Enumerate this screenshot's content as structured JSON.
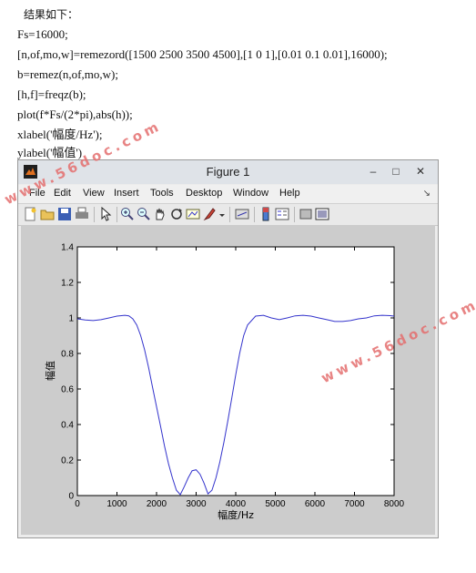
{
  "document": {
    "heading": "结果如下：",
    "code_lines": [
      "Fs=16000;",
      "[n,of,mo,w]=remezord([1500 2500 3500 4500],[1 0 1],[0.01 0.1 0.01],16000);",
      "b=remez(n,of,mo,w);",
      "[h,f]=freqz(b);",
      "plot(f*Fs/(2*pi),abs(h));",
      "xlabel('幅度/Hz');",
      "ylabel('幅值')"
    ]
  },
  "window": {
    "title": "Figure 1",
    "controls": {
      "minimize": "–",
      "maximize": "□",
      "close": "✕"
    },
    "menu": [
      "File",
      "Edit",
      "View",
      "Insert",
      "Tools",
      "Desktop",
      "Window",
      "Help"
    ],
    "menu_overflow": "↘",
    "toolbar_icons": [
      "new-figure-icon",
      "open-file-icon",
      "save-icon",
      "print-icon",
      "pointer-icon",
      "zoom-in-icon",
      "zoom-out-icon",
      "pan-icon",
      "rotate-icon",
      "data-cursor-icon",
      "brush-icon",
      "link-plot-icon",
      "colorbar-icon",
      "legend-icon",
      "hide-plot-tools-icon",
      "show-plot-tools-icon"
    ]
  },
  "watermarks": [
    "www.56doc.com",
    "www.56doc.com"
  ],
  "colors": {
    "line": "#3333cc",
    "plot_bg": "#ffffff",
    "figure_bg": "#cccccc",
    "watermark": "#e46f6f"
  },
  "chart_data": {
    "type": "line",
    "xlabel": "幅度/Hz",
    "ylabel": "幅值",
    "xlim": [
      0,
      8000
    ],
    "ylim": [
      0,
      1.4
    ],
    "xticks": [
      0,
      1000,
      2000,
      3000,
      4000,
      5000,
      6000,
      7000,
      8000
    ],
    "yticks": [
      0,
      0.2,
      0.4,
      0.6,
      0.8,
      1,
      1.2,
      1.4
    ],
    "series": [
      {
        "x": [
          0,
          200,
          400,
          600,
          800,
          1000,
          1200,
          1300,
          1400,
          1500,
          1600,
          1700,
          1800,
          1900,
          2000,
          2100,
          2200,
          2300,
          2400,
          2500,
          2600,
          2700,
          2800,
          2900,
          3000,
          3100,
          3200,
          3300,
          3400,
          3500,
          3600,
          3700,
          3800,
          3900,
          4000,
          4100,
          4200,
          4300,
          4500,
          4700,
          4900,
          5100,
          5300,
          5500,
          5700,
          5900,
          6100,
          6300,
          6500,
          6700,
          6900,
          7100,
          7300,
          7500,
          7700,
          7900,
          8000
        ],
        "y": [
          0.995,
          0.988,
          0.985,
          0.99,
          1.0,
          1.01,
          1.015,
          1.012,
          0.995,
          0.96,
          0.9,
          0.82,
          0.72,
          0.61,
          0.5,
          0.39,
          0.28,
          0.18,
          0.1,
          0.03,
          0.005,
          0.05,
          0.1,
          0.14,
          0.145,
          0.12,
          0.07,
          0.01,
          0.03,
          0.1,
          0.19,
          0.3,
          0.42,
          0.55,
          0.68,
          0.8,
          0.9,
          0.96,
          1.01,
          1.015,
          1.0,
          0.99,
          1.0,
          1.012,
          1.015,
          1.01,
          1.0,
          0.99,
          0.98,
          0.98,
          0.985,
          0.995,
          1.0,
          1.012,
          1.015,
          1.013,
          1.01
        ]
      }
    ]
  }
}
